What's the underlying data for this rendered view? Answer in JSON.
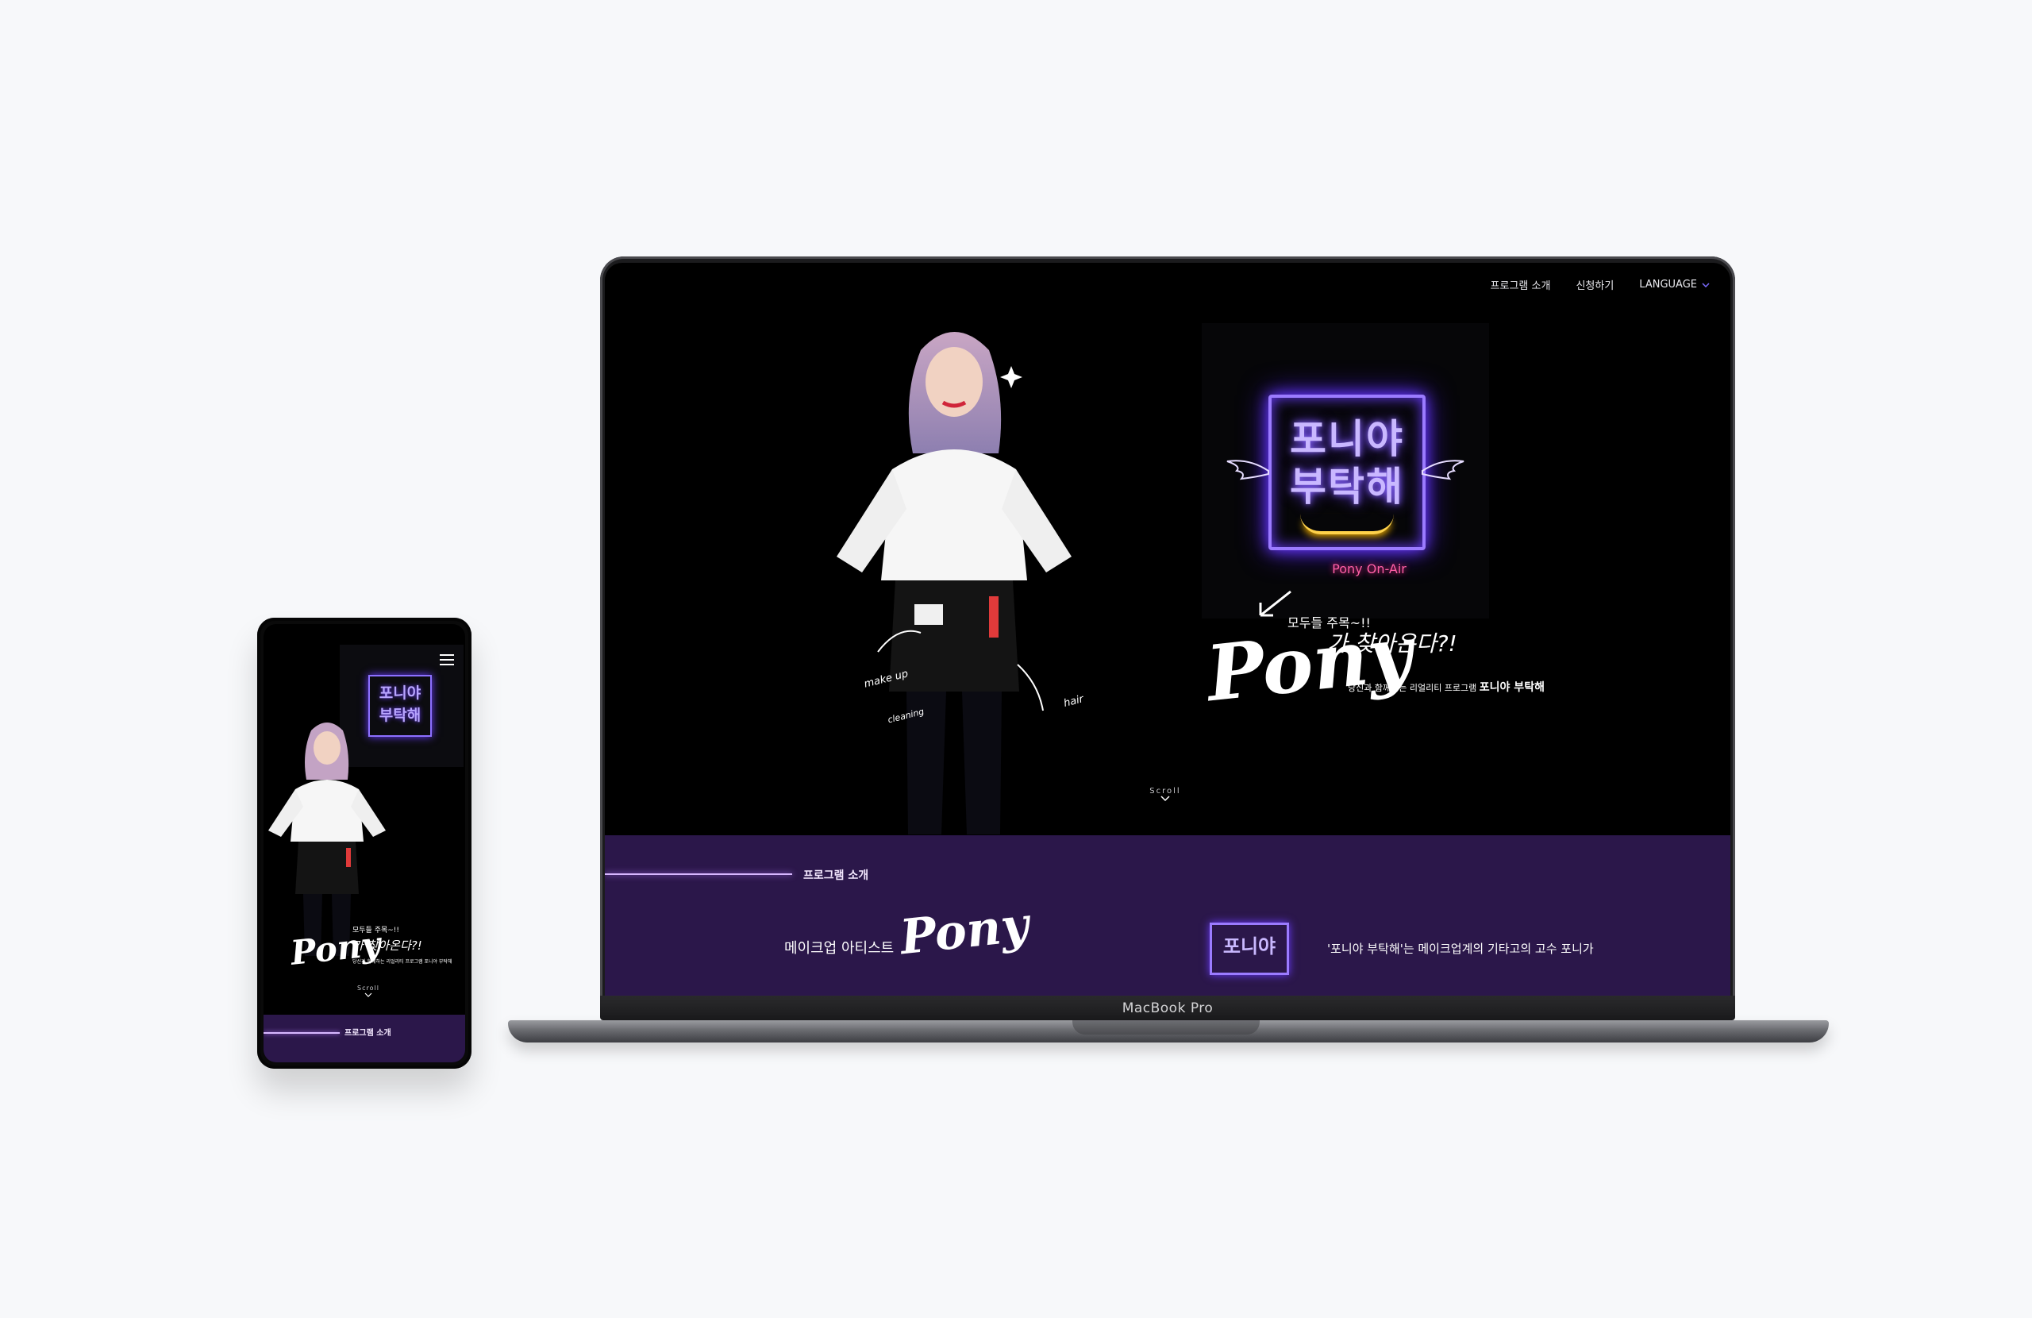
{
  "laptop": {
    "label": "MacBook Pro",
    "nav": {
      "items": [
        "프로그램 소개",
        "신청하기"
      ],
      "language_label": "LANGUAGE"
    },
    "hero": {
      "neon_line1": "포니야",
      "neon_line2": "부탁해",
      "neon_sub": "Pony On-Air",
      "arrow_note": "모두들 주목~!!",
      "script_word": "Pony",
      "tagline": "가 찾아온다?!",
      "desc_prefix": "당신과 함께하는 리얼리티 프로그램",
      "desc_emphasis": "포니야 부탁해",
      "doodles": [
        "make up",
        "hair",
        "cleaning"
      ],
      "scroll_label": "Scroll"
    },
    "intro": {
      "section_title": "프로그램 소개",
      "left_text": "메이크업 아티스트",
      "script_word": "Pony",
      "neon_mini": "포니야",
      "right_text": "'포니야 부탁해'는 메이크업계의 기타고의 고수 포니가"
    }
  },
  "phone": {
    "neon_line1": "포니야",
    "neon_line2": "부탁해",
    "arrow_note": "모두들 주목~!!",
    "script_word": "Pony",
    "tagline": "가 찾아온다?!",
    "desc": "당신과 함께하는 리얼리티 프로그램 포니야 부탁해",
    "scroll_label": "Scroll",
    "section_title": "프로그램 소개"
  },
  "colors": {
    "page_bg": "#f7f8fa",
    "band_purple": "#2b174a",
    "neon_purple": "#9b7bff",
    "neon_pink": "#ff5fa6",
    "smile_yellow": "#ffd24a"
  }
}
